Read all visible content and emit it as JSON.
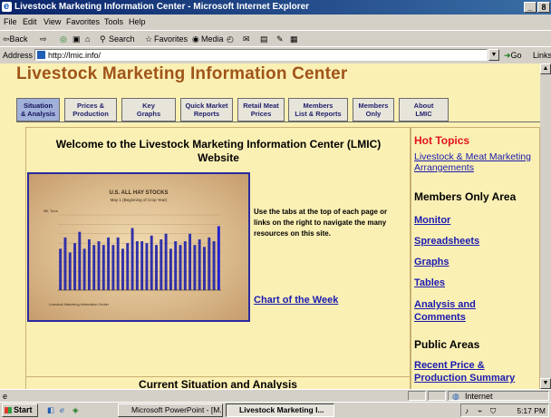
{
  "window": {
    "title": "Livestock Marketing Information Center - Microsoft Internet Explorer",
    "controls": [
      "_",
      "8"
    ]
  },
  "menu": [
    "File",
    "Edit",
    "View",
    "Favorites",
    "Tools",
    "Help"
  ],
  "toolbar": {
    "back": "⇦Back",
    "forward": "⇨",
    "search": "Search",
    "favorites": "Favorites",
    "media": "Media"
  },
  "address": {
    "label": "Address",
    "url": "http://lmic.info/",
    "go": "Go",
    "links": "Links"
  },
  "page": {
    "site_title": "Livestock Marketing Information Center",
    "tabs": [
      {
        "line1": "Situation",
        "line2": "& Analysis"
      },
      {
        "line1": "Prices &",
        "line2": "Production"
      },
      {
        "line1": "Key",
        "line2": "Graphs"
      },
      {
        "line1": "Quick Market",
        "line2": "Reports"
      },
      {
        "line1": "Retail Meat",
        "line2": "Prices"
      },
      {
        "line1": "Members",
        "line2": "List & Reports"
      },
      {
        "line1": "Members",
        "line2": "Only"
      },
      {
        "line1": "About",
        "line2": "LMIC"
      }
    ],
    "welcome": "Welcome to the Livestock Marketing Information Center (LMIC) Website",
    "nav_text": "Use the tabs at the top of each page or links on the right to navigate the many resources on this site.",
    "chart_of_week": "Chart of the Week",
    "current_situation": "Current Situation and Analysis"
  },
  "sidebar": {
    "hot_topics": "Hot Topics",
    "hot_link": "Livestock & Meat Marketing Arrangements",
    "members_area": "Members Only Area",
    "member_links": [
      "Monitor",
      "Spreadsheets",
      "Graphs",
      "Tables",
      "Analysis and Comments"
    ],
    "public_areas": "Public Areas",
    "public_link": "Recent Price & Production Summary"
  },
  "status": {
    "zone": "Internet"
  },
  "taskbar": {
    "start": "Start",
    "tasks": [
      "Microsoft PowerPoint - [M...",
      "Livestock Marketing I..."
    ],
    "clock": "5:17 PM"
  },
  "chart_data": {
    "type": "bar",
    "title": "U.S. ALL HAY STOCKS",
    "subtitle": "May 1 (Beginning of Crop Year)",
    "ylabel": "Mil. Tons",
    "source": "Livestock Marketing Information Center",
    "values": [
      22,
      28,
      20,
      25,
      31,
      22,
      27,
      24,
      26,
      24,
      28,
      24,
      28,
      22,
      25,
      33,
      26,
      26,
      25,
      29,
      24,
      27,
      30,
      22,
      26,
      24,
      26,
      30,
      24,
      27,
      23,
      28,
      26,
      34
    ],
    "ylim": [
      0,
      40
    ],
    "colors": {
      "bars": "#3030a8",
      "last_bar": "#2020d0"
    }
  }
}
